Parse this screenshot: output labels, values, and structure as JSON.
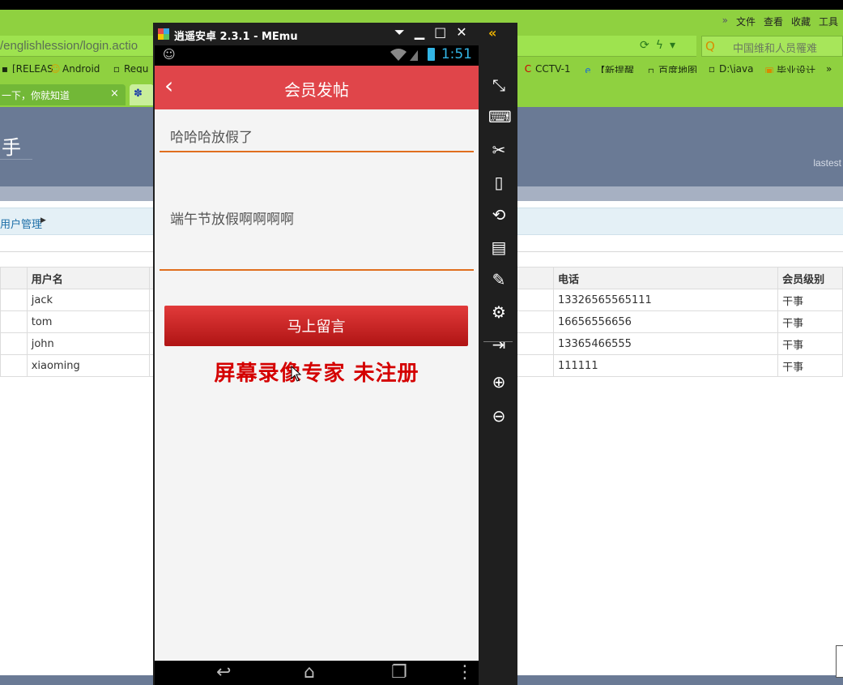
{
  "browser": {
    "menu": [
      "文件",
      "查看",
      "收藏",
      "工具"
    ],
    "menu_arrow": "»",
    "address": "/englishlession/login.actio",
    "search_placeholder": "中国维和人员罹难",
    "bookmarks": [
      {
        "label": "[RELEAS"
      },
      {
        "label": "Android"
      },
      {
        "label": "Requ"
      },
      {
        "label": "CCTV-1"
      },
      {
        "label": "【新提醒"
      },
      {
        "label": "百度地图"
      },
      {
        "label": "D:\\java"
      },
      {
        "label": "毕业设计"
      }
    ],
    "bookmarks_more": "»",
    "tab": {
      "label": "一下，你就知道",
      "close": "×"
    }
  },
  "site": {
    "title": "手",
    "header_right": "lastest",
    "breadcrumb": "用户管理"
  },
  "table": {
    "headers": {
      "username": "用户名",
      "phone": "电话",
      "level": "会员级别"
    },
    "rows": [
      {
        "username": "jack",
        "phone": "13326565565111",
        "level": "干事"
      },
      {
        "username": "tom",
        "phone": "16656556656",
        "level": "干事"
      },
      {
        "username": "john",
        "phone": "13365466555",
        "level": "干事"
      },
      {
        "username": "xiaoming",
        "phone": "111111",
        "level": "干事"
      }
    ]
  },
  "emulator": {
    "title": "逍遥安卓 2.3.1 - MEmu",
    "collapse": "«",
    "status_time": "1:51",
    "app_title": "会员发帖",
    "post_title_value": "哈哈哈放假了",
    "post_content_value": "端午节放假啊啊啊啊",
    "submit_label": "马上留言",
    "watermark": "屏幕录像专家  未注册"
  },
  "colors": {
    "browser_green": "#8fd140",
    "app_red": "#e0454a",
    "field_underline": "#e06e1e",
    "button_red": "#c82525",
    "watermark_red": "#d40000",
    "status_blue": "#33b5e5"
  }
}
